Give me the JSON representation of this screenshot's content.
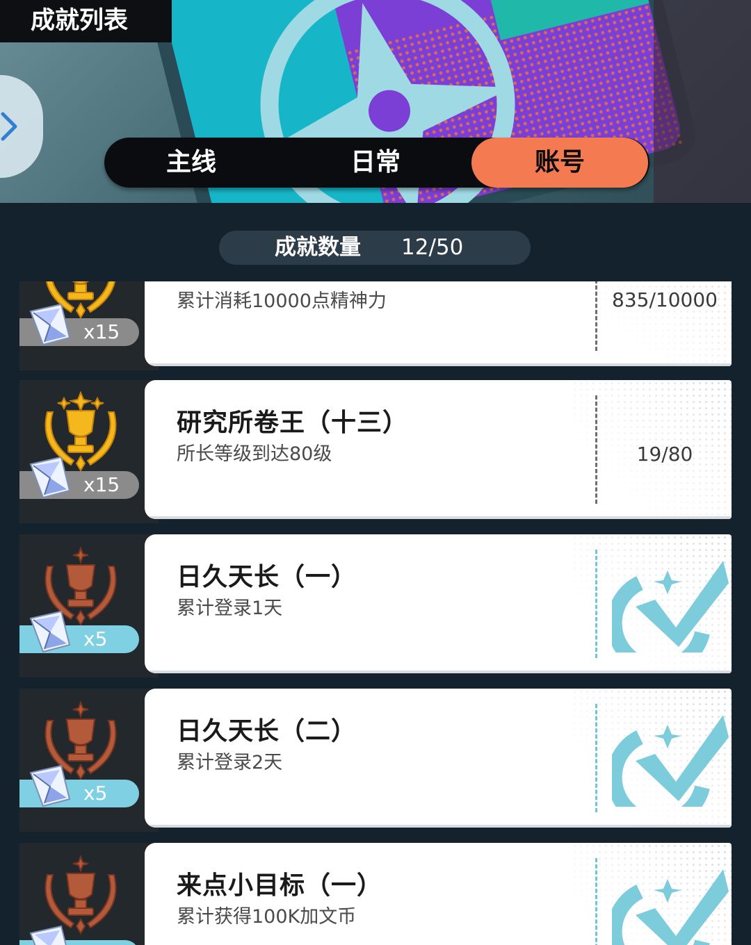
{
  "header": {
    "title": "成就列表"
  },
  "tabs": [
    {
      "label": "主线",
      "active": false
    },
    {
      "label": "日常",
      "active": false
    },
    {
      "label": "账号",
      "active": true
    }
  ],
  "counter": {
    "label": "成就数量",
    "value": "12/50"
  },
  "achievements": [
    {
      "name": "",
      "desc": "累计消耗10000点精神力",
      "progress": "835/10000",
      "reward_qty": "x15",
      "tier": "gold",
      "completed": false
    },
    {
      "name": "研究所卷王（十三）",
      "desc": "所长等级到达80级",
      "progress": "19/80",
      "reward_qty": "x15",
      "tier": "gold",
      "completed": false
    },
    {
      "name": "日久天长（一）",
      "desc": "累计登录1天",
      "progress": "",
      "reward_qty": "x5",
      "tier": "bronze",
      "completed": true
    },
    {
      "name": "日久天长（二）",
      "desc": "累计登录2天",
      "progress": "",
      "reward_qty": "x5",
      "tier": "bronze",
      "completed": true
    },
    {
      "name": "来点小目标（一）",
      "desc": "累计获得100K加文币",
      "progress": "",
      "reward_qty": "",
      "tier": "bronze",
      "completed": true
    }
  ],
  "colors": {
    "accent_tab": "#f47a52",
    "complete": "#6cc6d8",
    "gold": "#f4b81c",
    "bronze": "#b25a3a"
  },
  "icons": [
    "chevron-right-icon",
    "trophy-icon",
    "crystal-icon",
    "checkmark-badge-icon"
  ]
}
